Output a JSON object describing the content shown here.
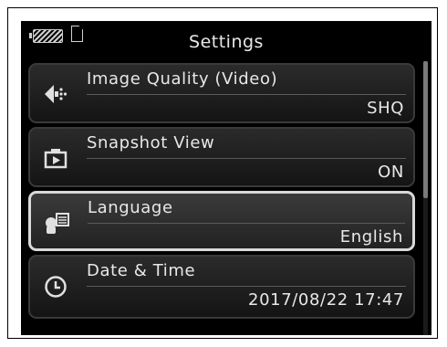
{
  "header": {
    "title": "Settings"
  },
  "items": [
    {
      "label": "Image Quality (Video)",
      "value": "SHQ",
      "icon": "image-quality-icon",
      "selected": false
    },
    {
      "label": "Snapshot View",
      "value": "ON",
      "icon": "snapshot-view-icon",
      "selected": false
    },
    {
      "label": "Language",
      "value": "English",
      "icon": "language-icon",
      "selected": true
    },
    {
      "label": "Date & Time",
      "value": "2017/08/22 17:47",
      "icon": "clock-icon",
      "selected": false
    }
  ],
  "status": {
    "battery_icon": "battery-icon",
    "card_icon": "memory-card-icon"
  },
  "colors": {
    "background": "#000000",
    "text": "#e8e8e8",
    "selected_border": "#d9d9d9"
  }
}
